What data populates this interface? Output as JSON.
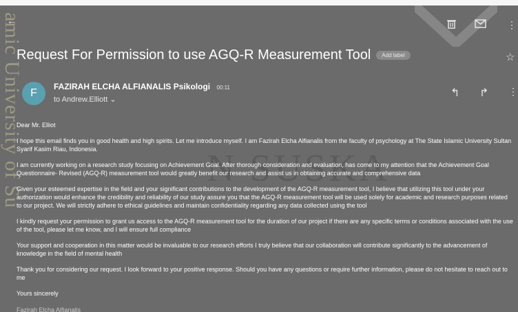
{
  "watermark": {
    "left_text": "amic University of Su",
    "center_text": "N SUSKA"
  },
  "email": {
    "subject": "Request For Permission to use AGQ-R Measurement Tool",
    "label_chip": "Add label",
    "sender_initial": "F",
    "sender_name": "FAZIRAH ELCHA ALFIANALIS Psikologi",
    "time": "00:11",
    "recipient": "to Andrew.Elliott ⌄",
    "body": {
      "greeting": "Dear Mr. Elliot",
      "p1": "I hope this email finds you in good health and high spirits. Let me introduce myself. I am Fazirah Elcha Alfianalis from the faculty of psychology at The State Islamic University Sultan Syarif Kasim Riau, Indonesia.",
      "p2": "I am currently working on a research study focusing on Achievement Goal. After thorough consideration and evaluation, has come to my attention that the Achievement Goal Questionnaire- Revised (AGQ-R) measurement tool would greatly benefit our research and assist us in obtaining accurate and comprehensive data",
      "p3": "Given your esteemed expertise in the field and your significant contributions to the development of the AGQ-R measurement tool, I believe that utilizing this tool under your authorization would enhance the credibility and reliability of our study assure you that the AGQ-R measurement tool will be used solely for academic and research purposes related to our project. We will strictly adhere to ethical guidelines and maintain confidentiality regarding any data collected using the tool",
      "p4": "I kindly request your permission to grant us access to the AGQ-R measurement tool for the duration of our project if there are any specific terms or conditions associated with the use of the tool, please let me know, and I will ensure full compliance",
      "p5": "Your support and cooperation in this matter would be invaluable to our research efforts I truly believe that our collaboration will contribute significantly to the advancement of knowledge in the field of mental health",
      "p6": "Thank you for considering our request. I look forward to your positive response. Should you have any questions or require further information, please do not hesitate to reach out to me",
      "closing": "Yours sincerely",
      "signature": "Fazirah Elcha Alfianalis"
    }
  },
  "icons": {
    "back": "back-arrow-icon",
    "delete": "trash-icon",
    "mail": "mail-icon",
    "more": "more-vert-icon",
    "star": "star-icon",
    "reply": "reply-icon",
    "forward": "forward-icon"
  },
  "colors": {
    "background": "#6b6b6c",
    "text": "#ffffff",
    "avatar": "#5aa0b0"
  }
}
